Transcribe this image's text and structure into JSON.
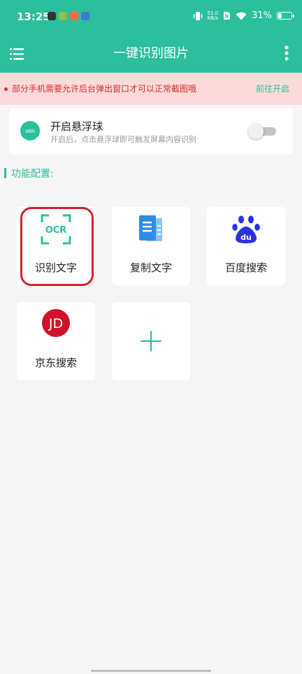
{
  "status_bar": {
    "time": "13:25",
    "net_speed_value": "51.0",
    "net_speed_unit": "KB/s",
    "battery": "31%",
    "battery_level": 0.31,
    "app_icon_colors": [
      "#333333",
      "#8bc34a",
      "#ff6f3c",
      "#3a7bd5"
    ]
  },
  "toolbar": {
    "title": "一键识别图片",
    "menu_icon": "hamburger-menu-icon",
    "more_icon": "more-vertical-icon"
  },
  "banner": {
    "text": "部分手机需要允许后台弹出窗口才可以正常截图哦",
    "link": "前往开启"
  },
  "float_ball": {
    "title": "开启悬浮球",
    "desc": "开启后，点击悬浮球即可触发屏幕内容识别",
    "enabled": false
  },
  "section": {
    "title": "功能配置:"
  },
  "features": [
    {
      "label": "识别文字",
      "icon": "ocr-icon",
      "icon_text": "OCR",
      "selected": true
    },
    {
      "label": "复制文字",
      "icon": "copy-document-icon"
    },
    {
      "label": "百度搜索",
      "icon": "baidu-icon",
      "icon_text": "du"
    },
    {
      "label": "京东搜索",
      "icon": "jd-icon",
      "icon_text": "JD"
    },
    {
      "label": "",
      "icon": "add-icon"
    }
  ],
  "colors": {
    "primary": "#2bbf9c",
    "banner_bg": "#fbdada",
    "warning_red": "#d9302c",
    "highlight_red": "#d81f2c",
    "baidu_blue": "#2932e1",
    "jd_red": "#d0102b"
  }
}
